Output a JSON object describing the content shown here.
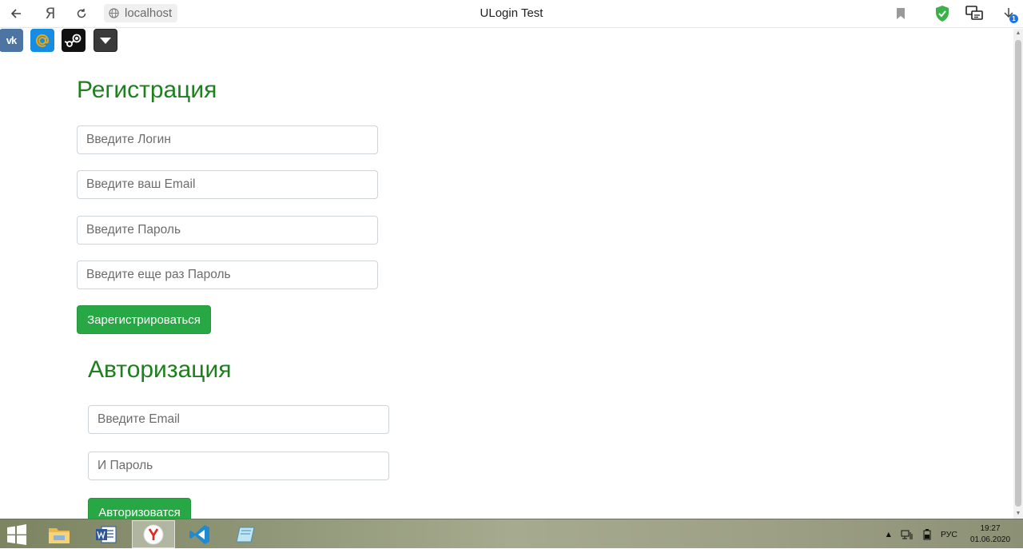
{
  "browser": {
    "url": "localhost",
    "title": "ULogin Test",
    "ya_label": "Я",
    "download_badge": "1"
  },
  "social_icons": [
    "vk-icon",
    "mail-ru-icon",
    "steam-icon",
    "dropdown-icon"
  ],
  "registration": {
    "heading": "Регистрация",
    "login_placeholder": "Введите Логин",
    "email_placeholder": "Введите ваш Email",
    "password_placeholder": "Введите Пароль",
    "password_repeat_placeholder": "Введите еще раз Пароль",
    "submit_label": "Зарегистрироваться"
  },
  "authorization": {
    "heading": "Авторизация",
    "email_placeholder": "Введите Email",
    "password_placeholder": "И Пароль",
    "submit_label": "Авторизоватся"
  },
  "taskbar": {
    "apps": [
      "file-explorer-icon",
      "word-icon",
      "yandex-browser-icon",
      "vscode-icon",
      "app-icon"
    ],
    "language": "РУС",
    "time": "19:27",
    "date": "01.06.2020"
  },
  "colors": {
    "heading_green": "#1e7f1e",
    "button_green": "#28a745"
  }
}
